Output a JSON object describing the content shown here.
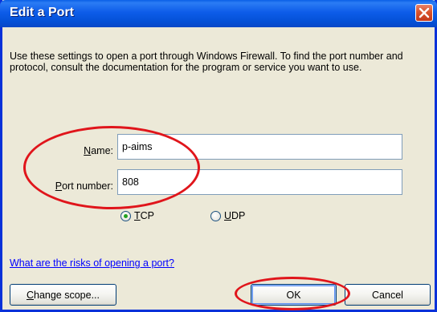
{
  "window": {
    "title": "Edit a Port",
    "close_icon": "close-icon"
  },
  "description": "Use these settings to open a port through Windows Firewall. To find the port number and protocol, consult the documentation for the program or service you want to use.",
  "fields": {
    "name": {
      "accel": "N",
      "rest": "ame:",
      "value": "p-aims"
    },
    "port": {
      "accel": "P",
      "rest": "ort number:",
      "value": "808"
    }
  },
  "protocol": {
    "options": [
      {
        "accel": "T",
        "rest": "CP",
        "checked": true
      },
      {
        "accel": "U",
        "rest": "DP",
        "checked": false
      }
    ]
  },
  "link": "What are the risks of opening a port?",
  "buttons": {
    "change_scope": {
      "accel": "C",
      "rest": "hange scope..."
    },
    "ok": "OK",
    "cancel": "Cancel"
  },
  "colors": {
    "title_bar": "#0d5ce9",
    "dialog_bg": "#ece9d8",
    "annotation": "#e0151b",
    "link": "#0000ff"
  }
}
